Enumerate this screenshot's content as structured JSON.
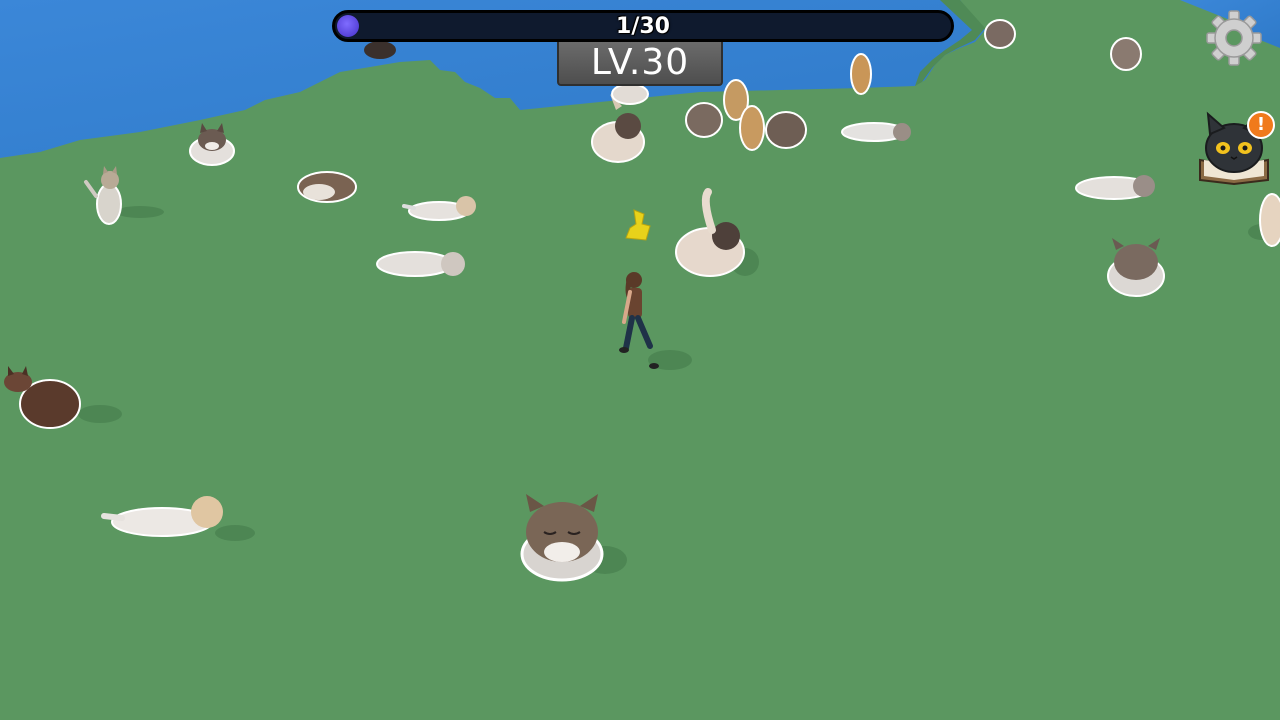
{
  "hud": {
    "progress_text": "1/30",
    "progress_fraction": 0.033,
    "level_text": "LV.30",
    "settings_icon": "gear-icon",
    "catalog_icon": "cat-book-icon",
    "notification_icon": "exclamation-icon",
    "notification_text": "!"
  },
  "colors": {
    "grass": "#5b9760",
    "water": "#3d86d6",
    "progress_bg": "#0f1a2e",
    "progress_fill": "#5a48e0",
    "level_badge": "#5c5c5c",
    "notification": "#f07a1c"
  },
  "world": {
    "player": "player-character",
    "pickup": "yellow-collectible"
  }
}
